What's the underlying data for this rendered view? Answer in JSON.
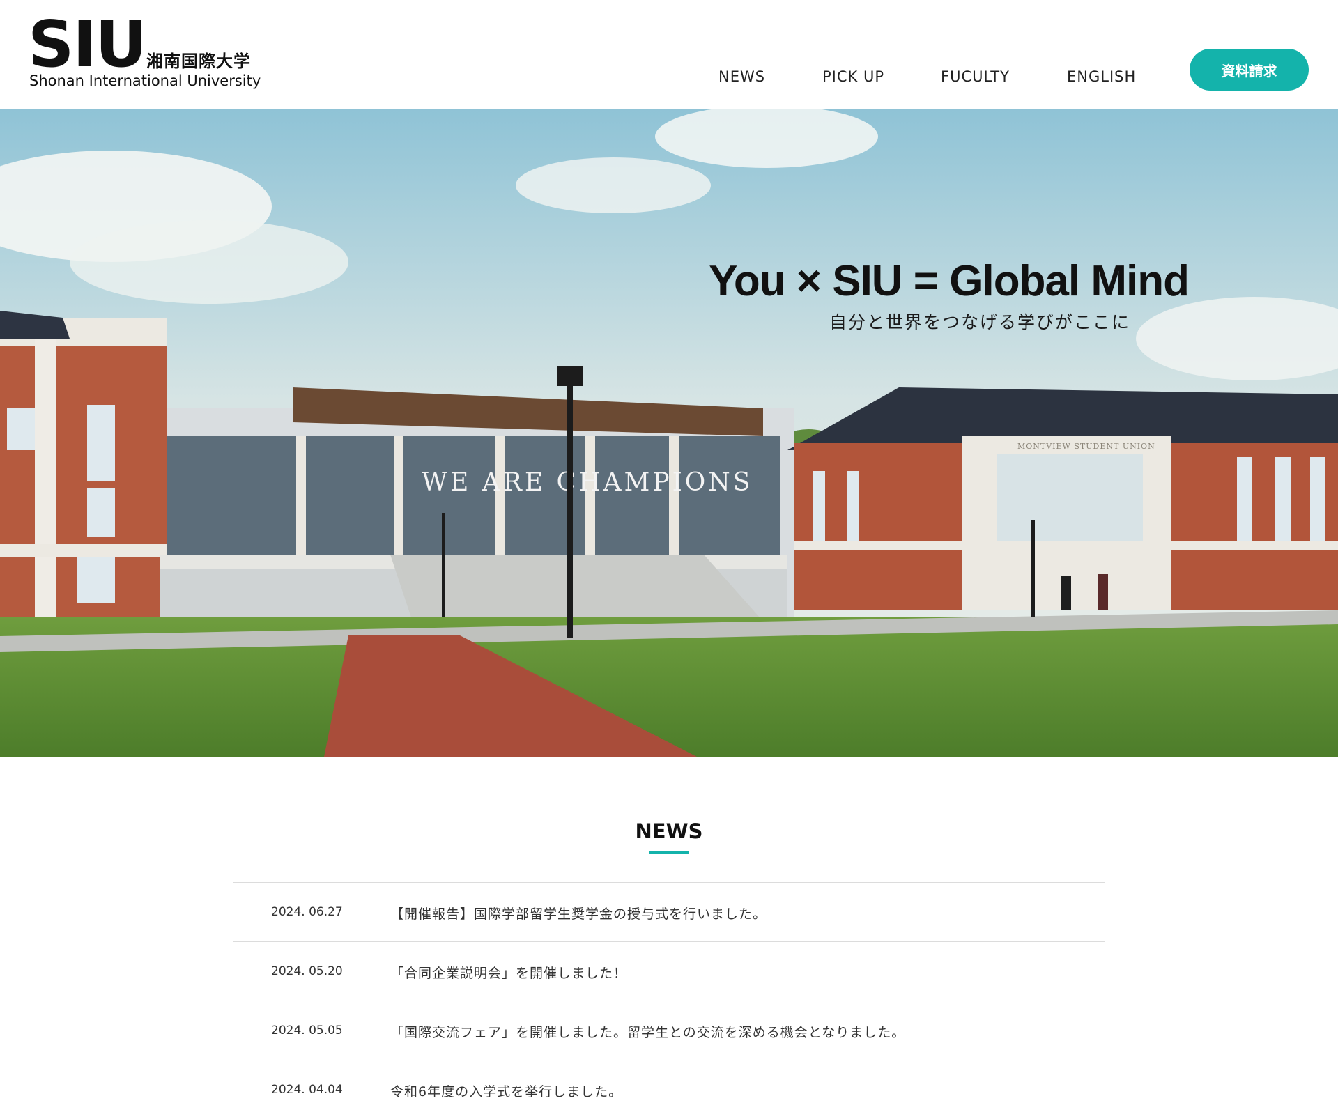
{
  "header": {
    "logo_mark": "SIU",
    "logo_jp": "湘南国際大学",
    "logo_en": "Shonan International University",
    "nav": [
      {
        "label": "NEWS"
      },
      {
        "label": "PICK UP"
      },
      {
        "label": "FUCULTY"
      },
      {
        "label": "ENGLISH"
      }
    ],
    "cta_label": "資料請求",
    "accent_color": "#14b3ab"
  },
  "hero": {
    "headline": "You × SIU = Global Mind",
    "subline": "自分と世界をつなげる学びがここに",
    "building_sign": "MONTVIEW STUDENT UNION",
    "glass_lettering": "WE ARE CHAMPIONS"
  },
  "news": {
    "title": "NEWS",
    "items": [
      {
        "date": "2024. 06.27",
        "text": "【開催報告】国際学部留学生奨学金の授与式を行いました。"
      },
      {
        "date": "2024. 05.20",
        "text": "「合同企業説明会」を開催しました！"
      },
      {
        "date": "2024. 05.05",
        "text": "「国際交流フェア」を開催しました。留学生との交流を深める機会となりました。"
      },
      {
        "date": "2024. 04.04",
        "text": "令和6年度の入学式を挙行しました。"
      }
    ]
  }
}
